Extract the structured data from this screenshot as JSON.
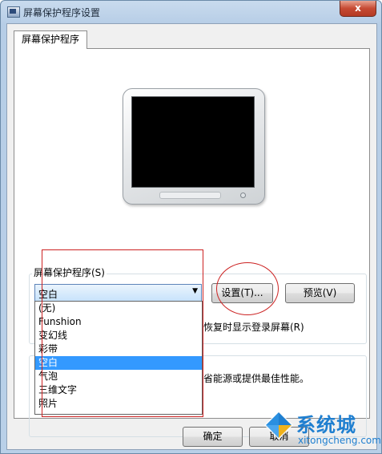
{
  "window": {
    "title": "屏幕保护程序设置",
    "close_label": "x"
  },
  "tabs": [
    {
      "label": "屏幕保护程序"
    }
  ],
  "screensaver": {
    "group_label": "屏幕保护程序(S)",
    "selected": "空白",
    "settings_button": "设置(T)...",
    "preview_button": "预览(V)",
    "resume_text": "恢复时显示登录屏幕(R)",
    "power_text": "省能源或提供最佳性能。",
    "options": [
      "(无)",
      "Funshion",
      "变幻线",
      "彩带",
      "空白",
      "气泡",
      "三维文字",
      "照片"
    ],
    "selected_index": 4
  },
  "buttons": {
    "ok": "确定",
    "cancel": "取消"
  },
  "watermark": {
    "cn": "系统城",
    "en": "xitongcheng.com"
  },
  "colors": {
    "selection": "#3399ff",
    "annotation": "#cc2222",
    "watermark": "#1f7fd0"
  }
}
